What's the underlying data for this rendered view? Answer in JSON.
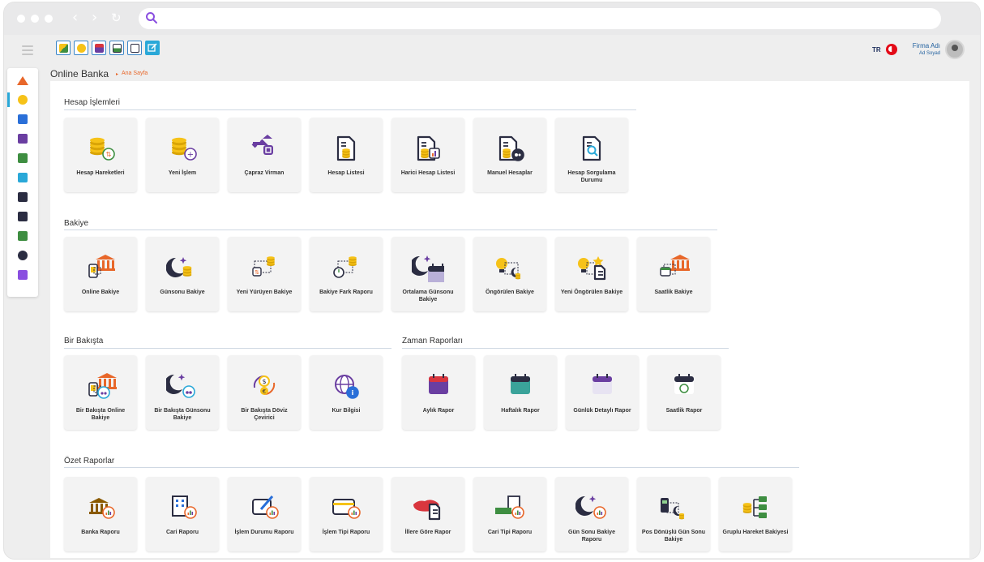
{
  "app": {
    "title": "Online Banka",
    "breadcrumb_sep": "▸",
    "breadcrumb": "Ana Sayfa"
  },
  "header": {
    "language": "TR",
    "firm": "Firma Adı",
    "user": "Ad Soyad"
  },
  "colors": {
    "accent": "#2aa8d8",
    "gold": "#f6c218",
    "green": "#3e8e41",
    "purple": "#6a3ea1",
    "dark": "#2b2d42",
    "orange": "#e8672a"
  },
  "quick_actions": [
    {
      "icon": "import-icon"
    },
    {
      "icon": "coins-transfer-icon"
    },
    {
      "icon": "calendar-icon"
    },
    {
      "icon": "image-report-icon"
    },
    {
      "icon": "document-search-icon"
    },
    {
      "icon": "edit-icon"
    }
  ],
  "sidebar": [
    {
      "icon": "home-icon"
    },
    {
      "icon": "coins-icon"
    },
    {
      "icon": "document-icon"
    },
    {
      "icon": "camera-icon"
    },
    {
      "icon": "battery-icon"
    },
    {
      "icon": "card-icon"
    },
    {
      "icon": "building-icon"
    },
    {
      "icon": "megaphone-icon"
    },
    {
      "icon": "gears-icon"
    },
    {
      "icon": "globe-icon"
    },
    {
      "icon": "report-icon"
    }
  ],
  "sections": {
    "hesap": {
      "title": "Hesap İşlemleri",
      "items": [
        {
          "label": "Hesap Hareketleri",
          "icon": "coins-arrows-icon"
        },
        {
          "label": "Yeni İşlem",
          "icon": "coins-plus-icon"
        },
        {
          "label": "Çapraz Virman",
          "icon": "swap-icon"
        },
        {
          "label": "Hesap Listesi",
          "icon": "doc-coins-icon"
        },
        {
          "label": "Harici Hesap Listesi",
          "icon": "doc-chart-icon"
        },
        {
          "label": "Manuel Hesaplar",
          "icon": "doc-gear-icon"
        },
        {
          "label": "Hesap Sorgulama Durumu",
          "icon": "doc-search-icon"
        }
      ]
    },
    "bakiye": {
      "title": "Bakiye",
      "items": [
        {
          "label": "Online Bakiye",
          "icon": "bank-phone-icon"
        },
        {
          "label": "Günsonu Bakiye",
          "icon": "moon-coins-icon"
        },
        {
          "label": "Yeni Yürüyen Bakiye",
          "icon": "flow-coins-icon"
        },
        {
          "label": "Bakiye Fark Raporu",
          "icon": "clock-coins-icon"
        },
        {
          "label": "Ortalama Günsonu Bakiye",
          "icon": "moon-calendar-icon"
        },
        {
          "label": "Öngörülen Bakiye",
          "icon": "bulb-moon-icon"
        },
        {
          "label": "Yeni Öngörülen Bakiye",
          "icon": "bulb-star-icon"
        },
        {
          "label": "Saatlik Bakiye",
          "icon": "bank-clock-icon"
        }
      ]
    },
    "birbakista": {
      "title": "Bir Bakışta",
      "items": [
        {
          "label": "Bir Bakışta Online Bakiye",
          "icon": "bank-binoculars-icon"
        },
        {
          "label": "Bir Bakışta Günsonu Bakiye",
          "icon": "moon-binoculars-icon"
        },
        {
          "label": "Bir Bakışta Döviz Çevirici",
          "icon": "currency-exchange-icon"
        },
        {
          "label": "Kur Bilgisi",
          "icon": "globe-info-icon"
        }
      ]
    },
    "zaman": {
      "title": "Zaman Raporları",
      "items": [
        {
          "label": "Aylık Rapor",
          "icon": "calendar-month-icon"
        },
        {
          "label": "Haftalık Rapor",
          "icon": "calendar-week-icon"
        },
        {
          "label": "Günlük Detaylı Rapor",
          "icon": "calendar-day-icon"
        },
        {
          "label": "Saatlik Rapor",
          "icon": "calendar-clock-icon"
        }
      ]
    },
    "ozet": {
      "title": "Özet Raporlar",
      "items": [
        {
          "label": "Banka Raporu",
          "icon": "bank-report-icon"
        },
        {
          "label": "Cari Raporu",
          "icon": "building-report-icon"
        },
        {
          "label": "İşlem Durumu Raporu",
          "icon": "edit-report-icon"
        },
        {
          "label": "İşlem Tipi Raporu",
          "icon": "card-report-icon"
        },
        {
          "label": "İllere Göre Rapor",
          "icon": "map-report-icon"
        },
        {
          "label": "Cari Tipi Raporu",
          "icon": "truck-report-icon"
        },
        {
          "label": "Gün Sonu Bakiye Raporu",
          "icon": "moon-report-icon"
        },
        {
          "label": "Pos Dönüşlü Gün Sonu Bakiye",
          "icon": "pos-moon-icon"
        },
        {
          "label": "Gruplu Hareket Bakiyesi",
          "icon": "grouped-coins-icon"
        }
      ]
    }
  }
}
